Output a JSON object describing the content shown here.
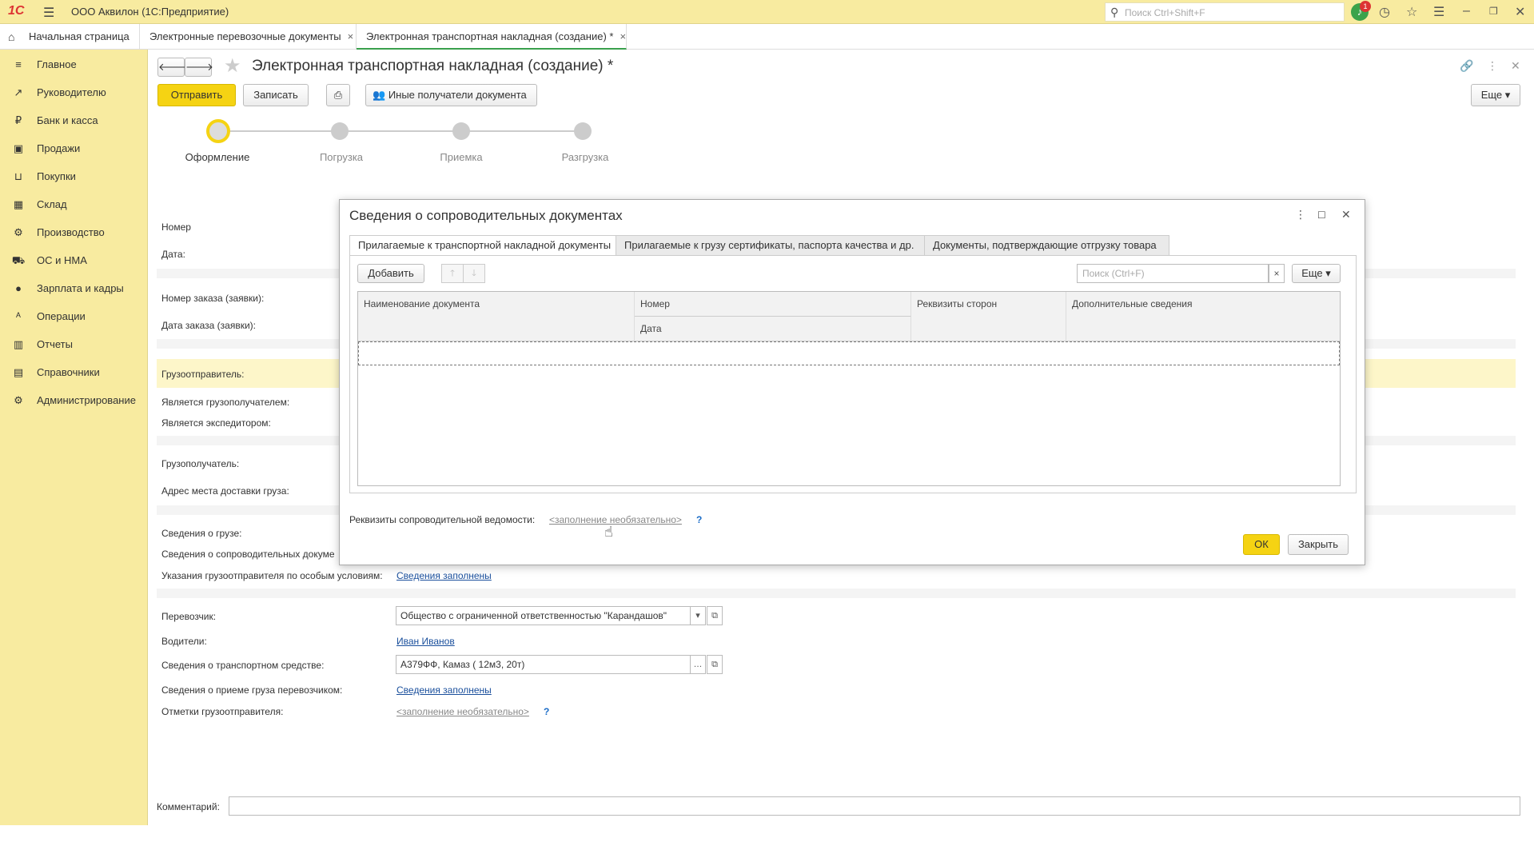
{
  "topbar": {
    "logo": "1С",
    "title": "ООО Аквилон  (1С:Предприятие)",
    "search_placeholder": "Поиск Ctrl+Shift+F",
    "notification_count": "1"
  },
  "tabs": {
    "home": "Начальная страница",
    "t1": "Электронные перевозочные документы",
    "t2": "Электронная транспортная накладная (создание) *",
    "close": "×"
  },
  "sidebar": {
    "items": [
      {
        "label": "Главное",
        "icon": "≡"
      },
      {
        "label": "Руководителю",
        "icon": "↗"
      },
      {
        "label": "Банк и касса",
        "icon": "₽"
      },
      {
        "label": "Продажи",
        "icon": "▣"
      },
      {
        "label": "Покупки",
        "icon": "⊔"
      },
      {
        "label": "Склад",
        "icon": "▦"
      },
      {
        "label": "Производство",
        "icon": "⚙"
      },
      {
        "label": "ОС и НМА",
        "icon": "⛟"
      },
      {
        "label": "Зарплата и кадры",
        "icon": "●"
      },
      {
        "label": "Операции",
        "icon": "ᴬ"
      },
      {
        "label": "Отчеты",
        "icon": "▥"
      },
      {
        "label": "Справочники",
        "icon": "▤"
      },
      {
        "label": "Администрирование",
        "icon": "⚙"
      }
    ]
  },
  "form": {
    "title": "Электронная транспортная накладная (создание) *",
    "send_btn": "Отправить",
    "save_btn": "Записать",
    "recipients_btn": "Иные получатели документа",
    "more_btn": "Еще",
    "steps": [
      "Оформление",
      "Погрузка",
      "Приемка",
      "Разгрузка"
    ],
    "labels": {
      "number": "Номер",
      "date": "Дата:",
      "order_number": "Номер заказа (заявки):",
      "order_date": "Дата заказа (заявки):",
      "shipper": "Грузоотправитель:",
      "is_consignee": "Является грузополучателем:",
      "is_forwarder": "Является экспедитором:",
      "consignee": "Грузополучатель:",
      "delivery_address": "Адрес места доставки груза:",
      "cargo_info": "Сведения о грузе:",
      "accompany_docs": "Сведения о сопроводительных докуме",
      "special_conditions": "Указания грузоотправителя по особым условиям:",
      "carrier": "Перевозчик:",
      "drivers": "Водители:",
      "vehicle": "Сведения о транспортном средстве:",
      "acceptance": "Сведения о приеме груза перевозчиком:",
      "shipper_notes": "Отметки грузоотправителя:",
      "comment": "Комментарий:"
    },
    "values": {
      "special_conditions_link": "Сведения заполнены",
      "carrier": "Общество с ограниченной ответственностью \"Карандашов\"",
      "driver": "Иван Иванов",
      "vehicle": "А379ФФ, Камаз ( 12м3, 20т)",
      "acceptance_link": "Сведения заполнены",
      "shipper_notes_link": "<заполнение необязательно>",
      "help": "?"
    }
  },
  "dialog": {
    "title": "Сведения о сопроводительных документах",
    "tabs": [
      "Прилагаемые к транспортной накладной документы",
      "Прилагаемые к грузу сертификаты, паспорта качества и др.",
      "Документы, подтверждающие отгрузку товара"
    ],
    "add_btn": "Добавить",
    "search_placeholder": "Поиск (Ctrl+F)",
    "more_btn": "Еще",
    "columns": {
      "name": "Наименование документа",
      "number": "Номер",
      "date": "Дата",
      "parties": "Реквизиты сторон",
      "extra": "Дополнительные сведения"
    },
    "statement_label": "Реквизиты сопроводительной ведомости:",
    "statement_link": "<заполнение необязательно>",
    "help": "?",
    "ok_btn": "ОК",
    "close_btn": "Закрыть"
  }
}
